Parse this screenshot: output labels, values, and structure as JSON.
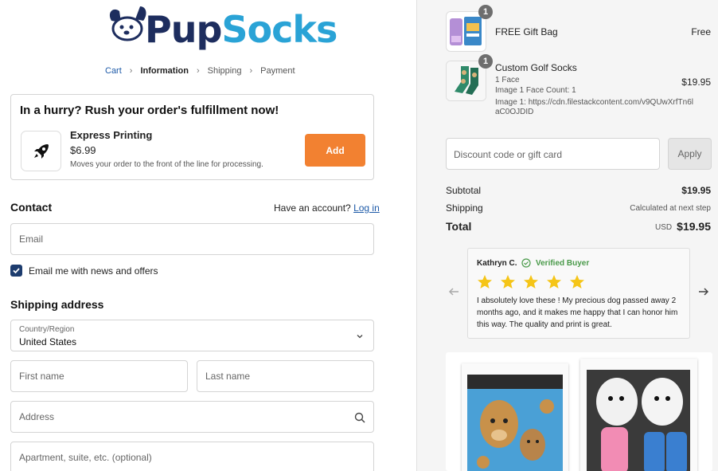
{
  "brand": {
    "name_part1": "Pup",
    "name_part2": "Socks"
  },
  "breadcrumb": {
    "items": [
      "Cart",
      "Information",
      "Shipping",
      "Payment"
    ],
    "active_index": 1
  },
  "rush": {
    "title": "In a hurry? Rush your order's fulfillment now!",
    "product_title": "Express Printing",
    "price": "$6.99",
    "description": "Moves your order to the front of the line for processing.",
    "add_label": "Add"
  },
  "contact": {
    "title": "Contact",
    "account_prompt": "Have an account?",
    "login_label": "Log in",
    "email_placeholder": "Email",
    "newsletter_label": "Email me with news and offers",
    "newsletter_checked": true
  },
  "shipping": {
    "title": "Shipping address",
    "country_label": "Country/Region",
    "country_value": "United States",
    "first_name_placeholder": "First name",
    "last_name_placeholder": "Last name",
    "address_placeholder": "Address",
    "apartment_placeholder": "Apartment, suite, etc. (optional)"
  },
  "cart": {
    "items": [
      {
        "name": "FREE Gift Bag",
        "price": "Free",
        "quantity": "1"
      },
      {
        "name": "Custom Golf Socks",
        "price": "$19.95",
        "quantity": "1",
        "option1": "1 Face",
        "option2": "Image 1 Face Count: 1",
        "option3": "Image 1: https://cdn.filestackcontent.com/v9QUwXrfTn6laC0OJDID"
      }
    ]
  },
  "discount": {
    "placeholder": "Discount code or gift card",
    "apply_label": "Apply"
  },
  "summary": {
    "subtotal_label": "Subtotal",
    "subtotal_value": "$19.95",
    "shipping_label": "Shipping",
    "shipping_value": "Calculated at next step",
    "total_label": "Total",
    "currency": "USD",
    "total_value": "$19.95"
  },
  "review": {
    "author": "Kathryn C.",
    "verified_label": "Verified Buyer",
    "rating": 5,
    "text": "I absolutely love these ! My precious dog passed away 2 months ago, and it makes me happy that I can honor him this way. The quality and print is great."
  },
  "colors": {
    "accent": "#f28131",
    "brand_navy": "#1d2d5e",
    "brand_blue": "#2aa3d6",
    "link": "#1d5aa8",
    "star": "#f5c518",
    "verified": "#4a9a4a"
  }
}
